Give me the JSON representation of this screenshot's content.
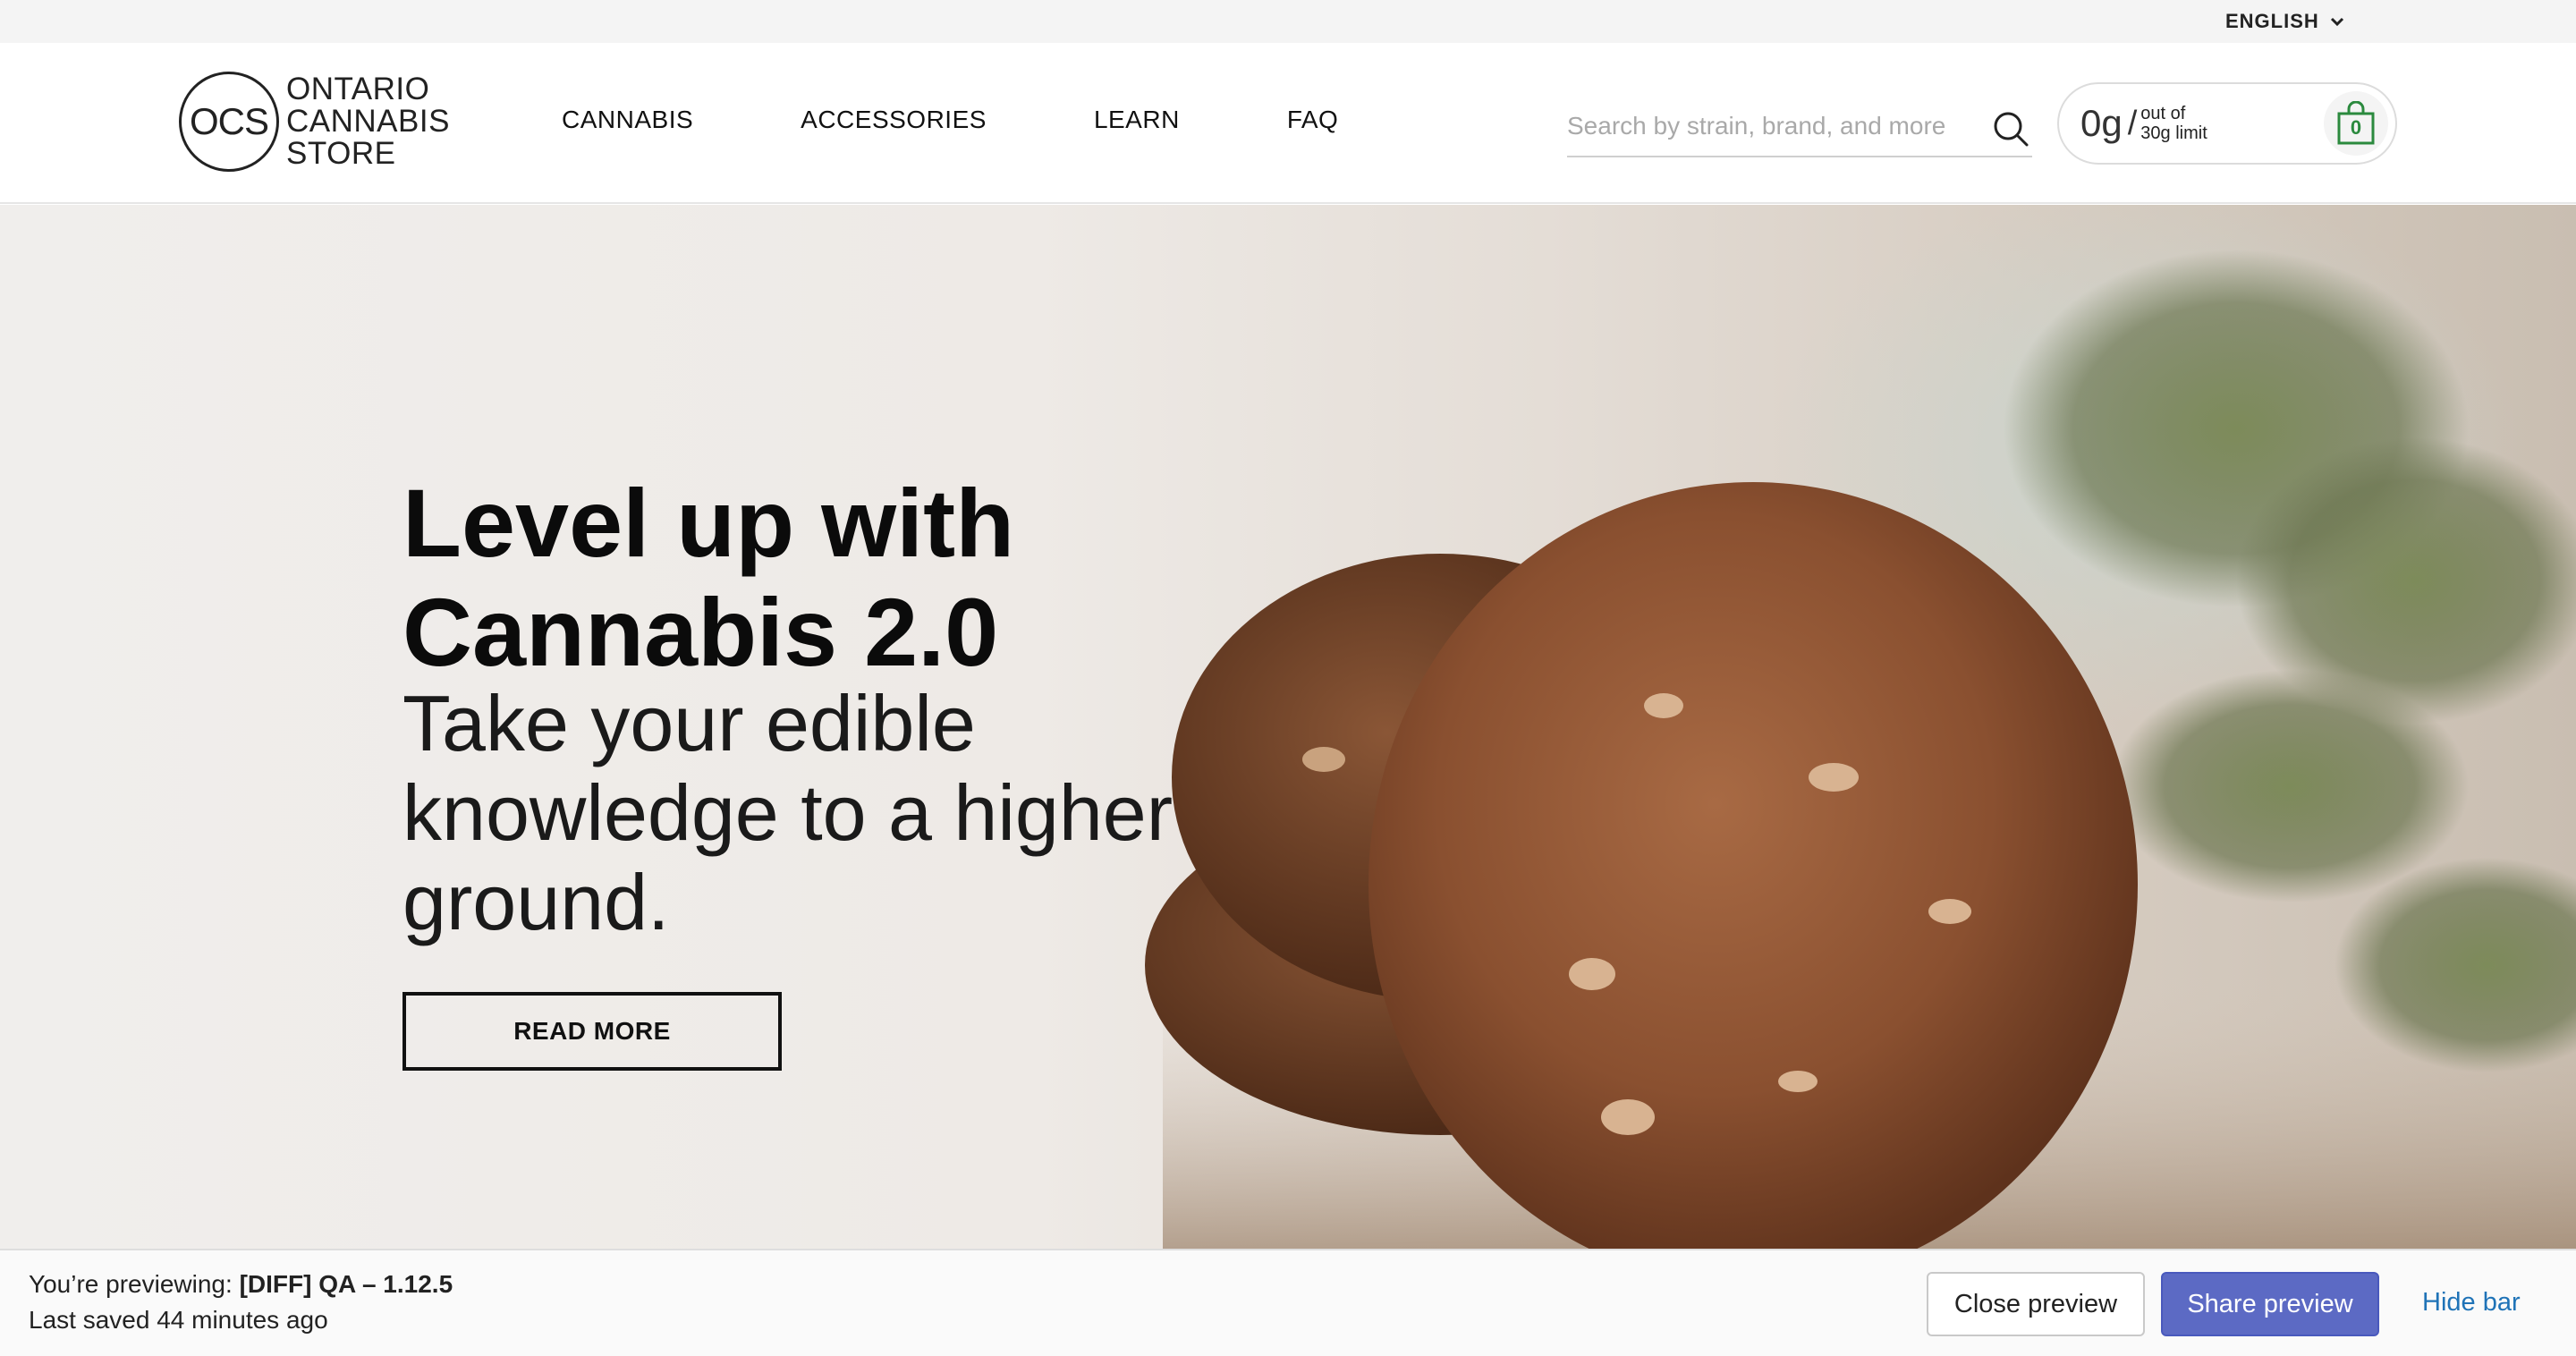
{
  "topbar": {
    "language": "ENGLISH"
  },
  "header": {
    "logo": {
      "mark": "OCS",
      "line1": "ONTARIO",
      "line2": "CANNABIS",
      "line3": "STORE"
    },
    "nav": [
      "CANNABIS",
      "ACCESSORIES",
      "LEARN",
      "FAQ"
    ],
    "search": {
      "placeholder": "Search by strain, brand, and more",
      "value": ""
    },
    "limit": {
      "amount": "0g",
      "slash": "/",
      "line1": "out of",
      "line2": "30g limit"
    },
    "cart": {
      "count": "0"
    }
  },
  "hero": {
    "title_line1": "Level up with",
    "title_line2": "Cannabis 2.0",
    "subtitle_line1": "Take your edible",
    "subtitle_line2": "knowledge to a higher",
    "subtitle_line3": "ground.",
    "cta": "READ MORE"
  },
  "preview_bar": {
    "prefix": "You’re previewing: ",
    "theme": "[DIFF] QA – 1.12.5",
    "saved": "Last saved 44 minutes ago",
    "close_label": "Close preview",
    "share_label": "Share preview",
    "hide_label": "Hide bar"
  },
  "colors": {
    "accent_green": "#2b8a3e",
    "share_button": "#5c6ac4",
    "link_blue": "#1f73b7"
  },
  "icons": [
    "chevron-down-icon",
    "search-icon",
    "shopping-bag-icon"
  ]
}
